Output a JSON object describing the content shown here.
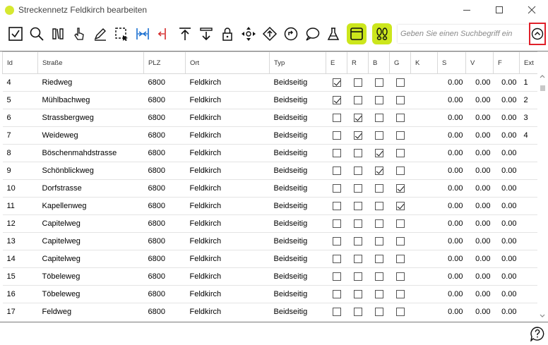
{
  "window": {
    "title": "Streckennetz Feldkirch  bearbeiten",
    "app_dot_color": "#d6e830",
    "accent_color": "#cce61c",
    "highlight_color": "#e0202a"
  },
  "toolbar": {
    "icons": [
      "check-icon",
      "search-icon",
      "columns-icon",
      "pointer-icon",
      "edit-icon",
      "select-area-icon",
      "merge-icon",
      "split-icon",
      "move-top-icon",
      "move-bottom-icon",
      "lock-icon",
      "move-icon",
      "direction-icon",
      "rotate-icon",
      "comment-icon",
      "lab-icon",
      "layout-icon",
      "footsteps-icon",
      "collapse-toolbar-icon"
    ],
    "search_placeholder": "Geben Sie einen Suchbegriff ein"
  },
  "table": {
    "columns": [
      "Id",
      "Straße",
      "PLZ",
      "Ort",
      "Typ",
      "E",
      "R",
      "B",
      "G",
      "K",
      "S",
      "V",
      "F",
      "Ext"
    ],
    "rows": [
      {
        "id": "4",
        "strasse": "Riedweg",
        "plz": "6800",
        "ort": "Feldkirch",
        "typ": "Beidseitig",
        "e": true,
        "r": false,
        "b": false,
        "g": false,
        "s": "0.00",
        "v": "0.00",
        "f": "0.00",
        "ext": "1"
      },
      {
        "id": "5",
        "strasse": "Mühlbachweg",
        "plz": "6800",
        "ort": "Feldkirch",
        "typ": "Beidseitig",
        "e": true,
        "r": false,
        "b": false,
        "g": false,
        "s": "0.00",
        "v": "0.00",
        "f": "0.00",
        "ext": "2"
      },
      {
        "id": "6",
        "strasse": "Strassbergweg",
        "plz": "6800",
        "ort": "Feldkirch",
        "typ": "Beidseitig",
        "e": false,
        "r": true,
        "b": false,
        "g": false,
        "s": "0.00",
        "v": "0.00",
        "f": "0.00",
        "ext": "3"
      },
      {
        "id": "7",
        "strasse": "Weideweg",
        "plz": "6800",
        "ort": "Feldkirch",
        "typ": "Beidseitig",
        "e": false,
        "r": true,
        "b": false,
        "g": false,
        "s": "0.00",
        "v": "0.00",
        "f": "0.00",
        "ext": "4"
      },
      {
        "id": "8",
        "strasse": "Böschenmahdstrasse",
        "plz": "6800",
        "ort": "Feldkirch",
        "typ": "Beidseitig",
        "e": false,
        "r": false,
        "b": true,
        "g": false,
        "s": "0.00",
        "v": "0.00",
        "f": "0.00",
        "ext": ""
      },
      {
        "id": "9",
        "strasse": "Schönblickweg",
        "plz": "6800",
        "ort": "Feldkirch",
        "typ": "Beidseitig",
        "e": false,
        "r": false,
        "b": true,
        "g": false,
        "s": "0.00",
        "v": "0.00",
        "f": "0.00",
        "ext": ""
      },
      {
        "id": "10",
        "strasse": "Dorfstrasse",
        "plz": "6800",
        "ort": "Feldkirch",
        "typ": "Beidseitig",
        "e": false,
        "r": false,
        "b": false,
        "g": true,
        "s": "0.00",
        "v": "0.00",
        "f": "0.00",
        "ext": ""
      },
      {
        "id": "11",
        "strasse": "Kapellenweg",
        "plz": "6800",
        "ort": "Feldkirch",
        "typ": "Beidseitig",
        "e": false,
        "r": false,
        "b": false,
        "g": true,
        "s": "0.00",
        "v": "0.00",
        "f": "0.00",
        "ext": ""
      },
      {
        "id": "12",
        "strasse": "Capitelweg",
        "plz": "6800",
        "ort": "Feldkirch",
        "typ": "Beidseitig",
        "e": false,
        "r": false,
        "b": false,
        "g": false,
        "s": "0.00",
        "v": "0.00",
        "f": "0.00",
        "ext": ""
      },
      {
        "id": "13",
        "strasse": "Capitelweg",
        "plz": "6800",
        "ort": "Feldkirch",
        "typ": "Beidseitig",
        "e": false,
        "r": false,
        "b": false,
        "g": false,
        "s": "0.00",
        "v": "0.00",
        "f": "0.00",
        "ext": ""
      },
      {
        "id": "14",
        "strasse": "Capitelweg",
        "plz": "6800",
        "ort": "Feldkirch",
        "typ": "Beidseitig",
        "e": false,
        "r": false,
        "b": false,
        "g": false,
        "s": "0.00",
        "v": "0.00",
        "f": "0.00",
        "ext": ""
      },
      {
        "id": "15",
        "strasse": "Töbeleweg",
        "plz": "6800",
        "ort": "Feldkirch",
        "typ": "Beidseitig",
        "e": false,
        "r": false,
        "b": false,
        "g": false,
        "s": "0.00",
        "v": "0.00",
        "f": "0.00",
        "ext": ""
      },
      {
        "id": "16",
        "strasse": "Töbeleweg",
        "plz": "6800",
        "ort": "Feldkirch",
        "typ": "Beidseitig",
        "e": false,
        "r": false,
        "b": false,
        "g": false,
        "s": "0.00",
        "v": "0.00",
        "f": "0.00",
        "ext": ""
      },
      {
        "id": "17",
        "strasse": "Feldweg",
        "plz": "6800",
        "ort": "Feldkirch",
        "typ": "Beidseitig",
        "e": false,
        "r": false,
        "b": false,
        "g": false,
        "s": "0.00",
        "v": "0.00",
        "f": "0.00",
        "ext": ""
      }
    ]
  }
}
